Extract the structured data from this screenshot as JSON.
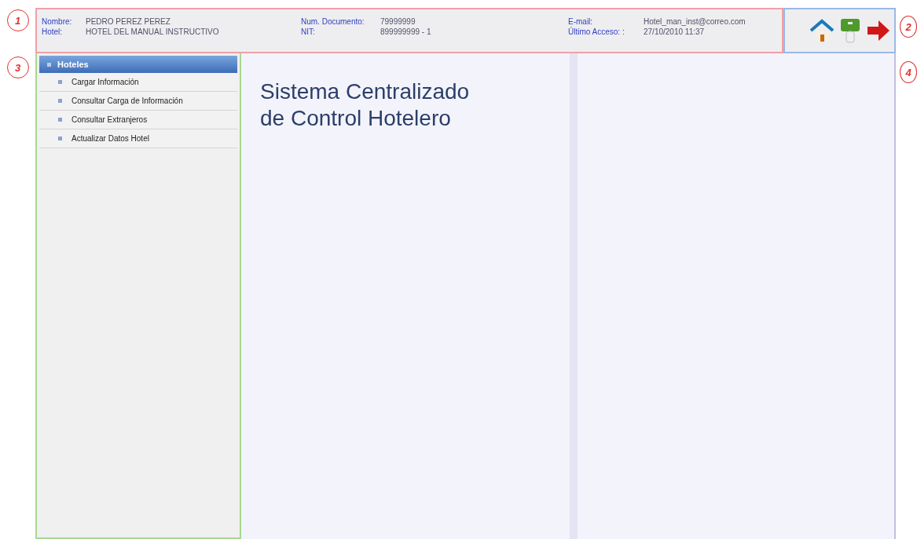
{
  "callouts": [
    {
      "number": "1"
    },
    {
      "number": "2"
    },
    {
      "number": "3"
    },
    {
      "number": "4"
    }
  ],
  "user_info": [
    {
      "label": "Nombre:",
      "value": "PEDRO PEREZ PEREZ"
    },
    {
      "label": "Num. Documento:",
      "value": "79999999"
    },
    {
      "label": "E-mail:",
      "value": "Hotel_man_inst@correo.com"
    },
    {
      "label": "Hotel:",
      "value": "HOTEL DEL MANUAL INSTRUCTIVO"
    },
    {
      "label": "NIT:",
      "value": "899999999 - 1"
    },
    {
      "label": "Último Acceso: :",
      "value": "27/10/2010 11:37"
    }
  ],
  "toolbar": [
    {
      "kind": "home"
    },
    {
      "kind": "key"
    },
    {
      "kind": "exit"
    }
  ],
  "sidebar": {
    "title": "Hoteles",
    "items": [
      {
        "label": "Cargar Información"
      },
      {
        "label": "Consultar Carga de Información"
      },
      {
        "label": "Consultar Extranjeros"
      },
      {
        "label": "Actualizar Datos Hotel"
      }
    ]
  },
  "main": {
    "title_lines": [
      "Sistema Centralizado",
      "de Control Hotelero"
    ]
  }
}
